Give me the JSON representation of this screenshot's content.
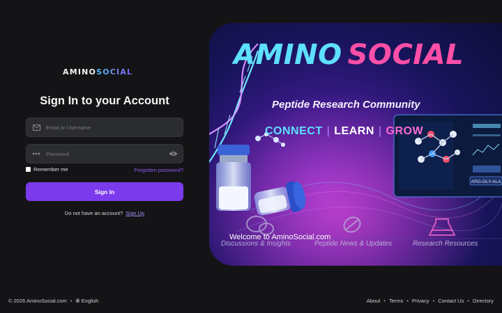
{
  "brand": {
    "part1": "AMINO",
    "part2": "SOCIAL"
  },
  "login": {
    "title": "Sign In to your Account",
    "email_placeholder": "Email or Username",
    "password_placeholder": "Password",
    "remember_label": "Remember me",
    "forgot_label": "Forgotten password?",
    "signin_label": "Sign In",
    "no_account_text": "Do not have an account?",
    "signup_label": "Sign Up"
  },
  "banner": {
    "title_part1": "AMINO",
    "title_part2": "SOCIAL",
    "subtitle": "Peptide Research Community",
    "tag_connect": "CONNECT",
    "tag_learn": "LEARN",
    "tag_grow": "GROW",
    "welcome": "Welcome to AminoSocial.com",
    "feature1": "Discussions & Insights",
    "feature2": "Peptide News & Updates",
    "feature3": "Research Resources",
    "screen_label": "ARG-GLY-ALA"
  },
  "footer": {
    "copyright": "© 2026 AminoSocial.com",
    "language": "English",
    "links": [
      "About",
      "Terms",
      "Privacy",
      "Contact Us",
      "Directory"
    ]
  },
  "colors": {
    "accent": "#7c3aed",
    "background": "#141416",
    "field": "#2b2c30"
  },
  "icons": [
    "mail-icon",
    "password-dots-icon",
    "eye-icon",
    "globe-icon"
  ]
}
